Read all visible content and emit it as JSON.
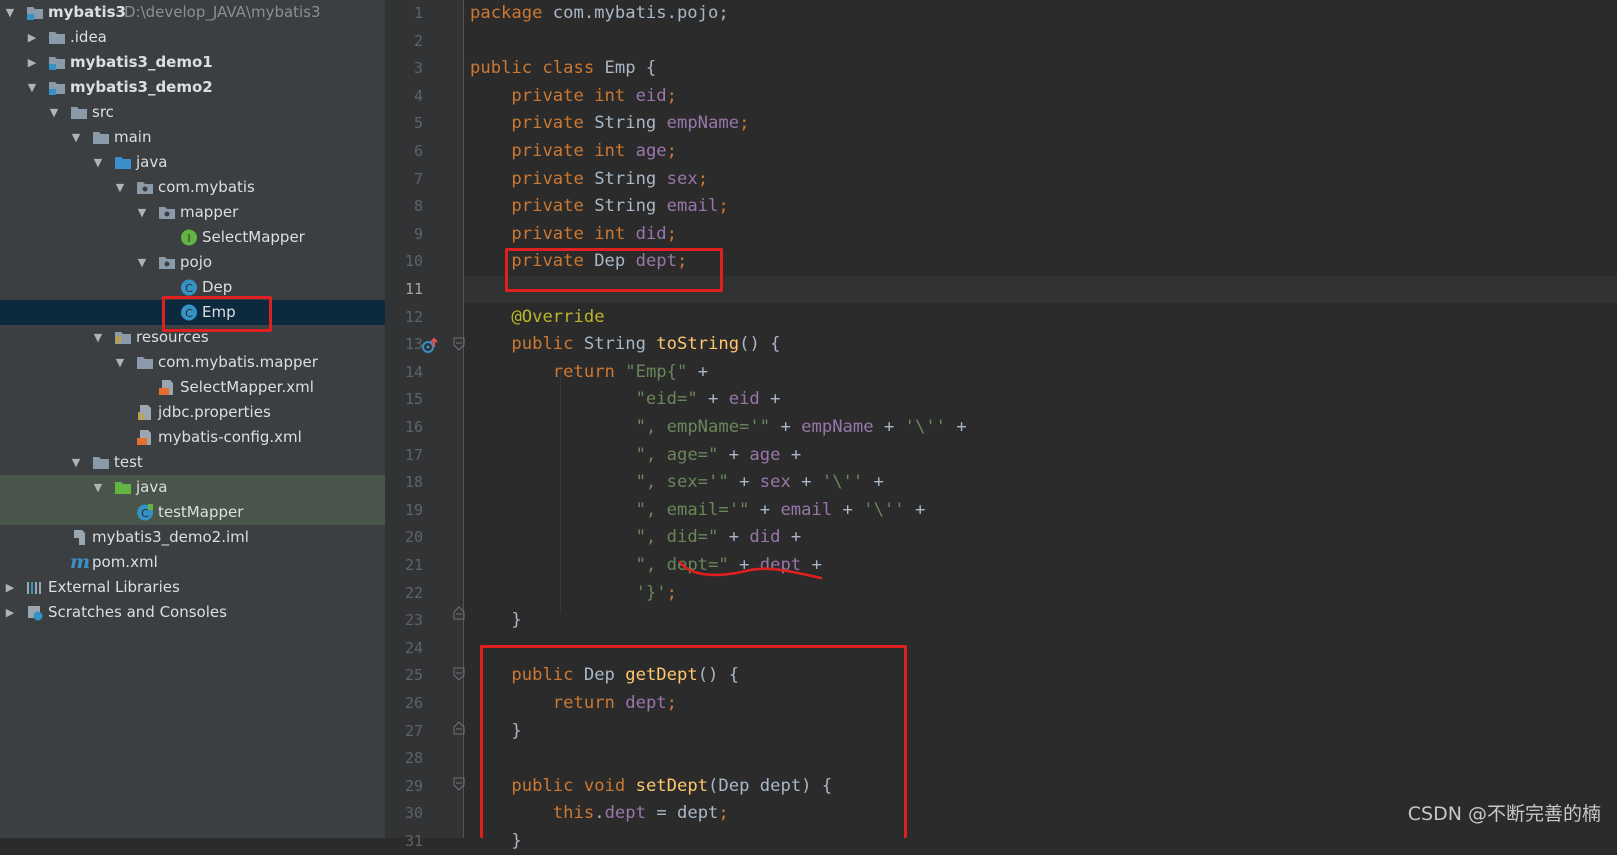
{
  "project_tree": {
    "root": {
      "label": "mybatis3",
      "path": "D:\\develop_JAVA\\mybatis3"
    },
    "items": [
      {
        "label": ".idea"
      },
      {
        "label": "mybatis3_demo1"
      },
      {
        "label": "mybatis3_demo2"
      },
      {
        "label": "src"
      },
      {
        "label": "main"
      },
      {
        "label": "java"
      },
      {
        "label": "com.mybatis"
      },
      {
        "label": "mapper"
      },
      {
        "label": "SelectMapper"
      },
      {
        "label": "pojo"
      },
      {
        "label": "Dep"
      },
      {
        "label": "Emp"
      },
      {
        "label": "resources"
      },
      {
        "label": "com.mybatis.mapper"
      },
      {
        "label": "SelectMapper.xml"
      },
      {
        "label": "jdbc.properties"
      },
      {
        "label": "mybatis-config.xml"
      },
      {
        "label": "test"
      },
      {
        "label": "java"
      },
      {
        "label": "testMapper"
      },
      {
        "label": "mybatis3_demo2.iml"
      },
      {
        "label": "pom.xml"
      },
      {
        "label": "External Libraries"
      },
      {
        "label": "Scratches and Consoles"
      }
    ],
    "icon_glyphs": {
      "interface": "I",
      "class": "C",
      "maven": "m"
    }
  },
  "editor": {
    "current_line": 11,
    "lines": [
      {
        "n": "1",
        "t": [
          [
            "kw",
            "package"
          ],
          [
            "p",
            " com.mybatis.pojo;"
          ]
        ]
      },
      {
        "n": "2",
        "t": []
      },
      {
        "n": "3",
        "t": [
          [
            "kw",
            "public class"
          ],
          [
            "p",
            " Emp {"
          ]
        ]
      },
      {
        "n": "4",
        "t": [
          [
            "p",
            "    "
          ],
          [
            "kw",
            "private int"
          ],
          [
            "p",
            " "
          ],
          [
            "fd",
            "eid"
          ],
          [
            "kw",
            ";"
          ]
        ]
      },
      {
        "n": "5",
        "t": [
          [
            "p",
            "    "
          ],
          [
            "kw",
            "private"
          ],
          [
            "p",
            " String "
          ],
          [
            "fd",
            "empName"
          ],
          [
            "kw",
            ";"
          ]
        ]
      },
      {
        "n": "6",
        "t": [
          [
            "p",
            "    "
          ],
          [
            "kw",
            "private int"
          ],
          [
            "p",
            " "
          ],
          [
            "fd",
            "age"
          ],
          [
            "kw",
            ";"
          ]
        ]
      },
      {
        "n": "7",
        "t": [
          [
            "p",
            "    "
          ],
          [
            "kw",
            "private"
          ],
          [
            "p",
            " String "
          ],
          [
            "fd",
            "sex"
          ],
          [
            "kw",
            ";"
          ]
        ]
      },
      {
        "n": "8",
        "t": [
          [
            "p",
            "    "
          ],
          [
            "kw",
            "private"
          ],
          [
            "p",
            " String "
          ],
          [
            "fd",
            "email"
          ],
          [
            "kw",
            ";"
          ]
        ]
      },
      {
        "n": "9",
        "t": [
          [
            "p",
            "    "
          ],
          [
            "kw",
            "private int"
          ],
          [
            "p",
            " "
          ],
          [
            "fd",
            "did"
          ],
          [
            "kw",
            ";"
          ]
        ]
      },
      {
        "n": "10",
        "t": [
          [
            "p",
            "    "
          ],
          [
            "kw",
            "private"
          ],
          [
            "p",
            " Dep "
          ],
          [
            "fd",
            "dept"
          ],
          [
            "kw",
            ";"
          ]
        ]
      },
      {
        "n": "11",
        "t": []
      },
      {
        "n": "12",
        "t": [
          [
            "p",
            "    "
          ],
          [
            "an",
            "@Override"
          ]
        ]
      },
      {
        "n": "13",
        "t": [
          [
            "p",
            "    "
          ],
          [
            "kw",
            "public"
          ],
          [
            "p",
            " String "
          ],
          [
            "mt",
            "toString"
          ],
          [
            "p",
            "() {"
          ]
        ]
      },
      {
        "n": "14",
        "t": [
          [
            "p",
            "        "
          ],
          [
            "kw",
            "return"
          ],
          [
            "p",
            " "
          ],
          [
            "st",
            "\"Emp{\""
          ],
          [
            "p",
            " +"
          ]
        ]
      },
      {
        "n": "15",
        "t": [
          [
            "p",
            "                "
          ],
          [
            "st",
            "\"eid=\""
          ],
          [
            "p",
            " + "
          ],
          [
            "fd",
            "eid"
          ],
          [
            "p",
            " +"
          ]
        ]
      },
      {
        "n": "16",
        "t": [
          [
            "p",
            "                "
          ],
          [
            "st",
            "\", empName='\""
          ],
          [
            "p",
            " + "
          ],
          [
            "fd",
            "empName"
          ],
          [
            "p",
            " + "
          ],
          [
            "st",
            "'\\''"
          ],
          [
            "p",
            " +"
          ]
        ]
      },
      {
        "n": "17",
        "t": [
          [
            "p",
            "                "
          ],
          [
            "st",
            "\", age=\""
          ],
          [
            "p",
            " + "
          ],
          [
            "fd",
            "age"
          ],
          [
            "p",
            " +"
          ]
        ]
      },
      {
        "n": "18",
        "t": [
          [
            "p",
            "                "
          ],
          [
            "st",
            "\", sex='\""
          ],
          [
            "p",
            " + "
          ],
          [
            "fd",
            "sex"
          ],
          [
            "p",
            " + "
          ],
          [
            "st",
            "'\\''"
          ],
          [
            "p",
            " +"
          ]
        ]
      },
      {
        "n": "19",
        "t": [
          [
            "p",
            "                "
          ],
          [
            "st",
            "\", email='\""
          ],
          [
            "p",
            " + "
          ],
          [
            "fd",
            "email"
          ],
          [
            "p",
            " + "
          ],
          [
            "st",
            "'\\''"
          ],
          [
            "p",
            " +"
          ]
        ]
      },
      {
        "n": "20",
        "t": [
          [
            "p",
            "                "
          ],
          [
            "st",
            "\", did=\""
          ],
          [
            "p",
            " + "
          ],
          [
            "fd",
            "did"
          ],
          [
            "p",
            " +"
          ]
        ]
      },
      {
        "n": "21",
        "t": [
          [
            "p",
            "                "
          ],
          [
            "st",
            "\", dept=\""
          ],
          [
            "p",
            " + "
          ],
          [
            "fd",
            "dept"
          ],
          [
            "p",
            " +"
          ]
        ]
      },
      {
        "n": "22",
        "t": [
          [
            "p",
            "                "
          ],
          [
            "st",
            "'}'"
          ],
          [
            "kw",
            ";"
          ]
        ]
      },
      {
        "n": "23",
        "t": [
          [
            "p",
            "    }"
          ]
        ]
      },
      {
        "n": "24",
        "t": []
      },
      {
        "n": "25",
        "t": [
          [
            "p",
            "    "
          ],
          [
            "kw",
            "public"
          ],
          [
            "p",
            " Dep "
          ],
          [
            "mt",
            "getDept"
          ],
          [
            "p",
            "() {"
          ]
        ]
      },
      {
        "n": "26",
        "t": [
          [
            "p",
            "        "
          ],
          [
            "kw",
            "return"
          ],
          [
            "p",
            " "
          ],
          [
            "fd",
            "dept"
          ],
          [
            "kw",
            ";"
          ]
        ]
      },
      {
        "n": "27",
        "t": [
          [
            "p",
            "    }"
          ]
        ]
      },
      {
        "n": "28",
        "t": []
      },
      {
        "n": "29",
        "t": [
          [
            "p",
            "    "
          ],
          [
            "kw",
            "public void"
          ],
          [
            "p",
            " "
          ],
          [
            "mt",
            "setDept"
          ],
          [
            "p",
            "(Dep dept) {"
          ]
        ]
      },
      {
        "n": "30",
        "t": [
          [
            "p",
            "        "
          ],
          [
            "kw",
            "this"
          ],
          [
            "p",
            "."
          ],
          [
            "fd",
            "dept"
          ],
          [
            "p",
            " = dept"
          ],
          [
            "kw",
            ";"
          ]
        ]
      },
      {
        "n": "31",
        "t": [
          [
            "p",
            "    }"
          ]
        ]
      }
    ]
  },
  "colors": {
    "keyword": "#cc7832",
    "field": "#9876aa",
    "string": "#6a8759",
    "annotation": "#bbb529",
    "method": "#ffc66d",
    "plain": "#a9b7c6",
    "highlight": "#e02020",
    "selection": "#0d293e"
  },
  "watermark": "CSDN @不断完善的楠"
}
